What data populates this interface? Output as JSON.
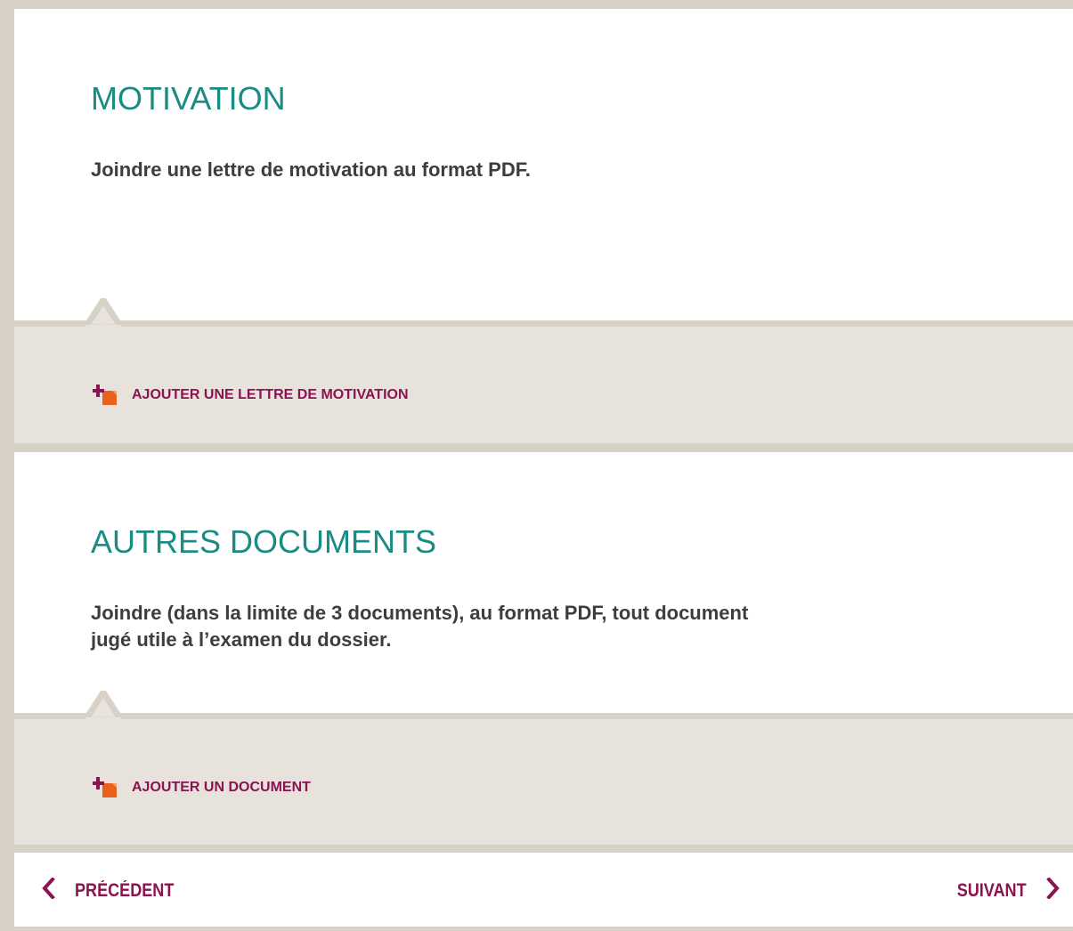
{
  "motivation": {
    "title": "MOTIVATION",
    "description": "Joindre une lettre de motivation au format PDF.",
    "add_label": "AJOUTER UNE LETTRE DE MOTIVATION",
    "add_icon": "add-document-icon"
  },
  "autres": {
    "title": "AUTRES DOCUMENTS",
    "description_line1": "Joindre (dans la limite de 3 documents), au format PDF, tout document",
    "description_line2": "jugé utile à l’examen du dossier.",
    "add_label": "AJOUTER UN DOCUMENT",
    "add_icon": "add-document-icon"
  },
  "navigation": {
    "prev_label": "PRÉCÉDENT",
    "prev_icon": "chevron-left-icon",
    "next_label": "SUIVANT",
    "next_icon": "chevron-right-icon"
  },
  "colors": {
    "title": "#1a8c84",
    "link": "#8a1350",
    "icon_plus": "#8a1350",
    "icon_doc": "#e8621c",
    "frame": "#d8d2c6",
    "panel_grey": "#e7e3dc"
  }
}
